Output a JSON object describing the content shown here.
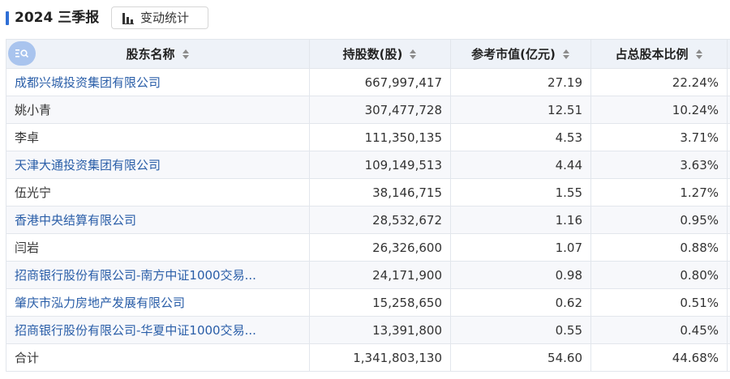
{
  "header": {
    "period_title": "2024 三季报",
    "change_button_label": "变动统计",
    "change_button_icon": "bar-chart-icon"
  },
  "table": {
    "columns": [
      "股东名称",
      "持股数(股)",
      "参考市值(亿元)",
      "占总股本比例"
    ],
    "rows": [
      {
        "name": "成都兴城投资集团有限公司",
        "shares": "667,997,417",
        "value": "27.19",
        "ratio": "22.24%",
        "link": true
      },
      {
        "name": "姚小青",
        "shares": "307,477,728",
        "value": "12.51",
        "ratio": "10.24%",
        "link": false
      },
      {
        "name": "李卓",
        "shares": "111,350,135",
        "value": "4.53",
        "ratio": "3.71%",
        "link": false
      },
      {
        "name": "天津大通投资集团有限公司",
        "shares": "109,149,513",
        "value": "4.44",
        "ratio": "3.63%",
        "link": true
      },
      {
        "name": "伍光宁",
        "shares": "38,146,715",
        "value": "1.55",
        "ratio": "1.27%",
        "link": false
      },
      {
        "name": "香港中央结算有限公司",
        "shares": "28,532,672",
        "value": "1.16",
        "ratio": "0.95%",
        "link": true
      },
      {
        "name": "闫岩",
        "shares": "26,326,600",
        "value": "1.07",
        "ratio": "0.88%",
        "link": false
      },
      {
        "name": "招商银行股份有限公司-南方中证1000交易...",
        "shares": "24,171,900",
        "value": "0.98",
        "ratio": "0.80%",
        "link": true
      },
      {
        "name": "肇庆市泓力房地产发展有限公司",
        "shares": "15,258,650",
        "value": "0.62",
        "ratio": "0.51%",
        "link": true
      },
      {
        "name": "招商银行股份有限公司-华夏中证1000交易...",
        "shares": "13,391,800",
        "value": "0.55",
        "ratio": "0.45%",
        "link": true
      }
    ],
    "total": {
      "name": "合计",
      "shares": "1,341,803,130",
      "value": "54.60",
      "ratio": "44.68%"
    }
  },
  "colors": {
    "accent": "#2f6fd6",
    "link": "#2a5ea8",
    "header_bg": "#eef2f8",
    "stripe_bg": "#f7f8fb",
    "search_button": "#a9c4ee"
  },
  "icons": [
    "bar-chart-icon",
    "sort-icon",
    "search-list-icon"
  ]
}
